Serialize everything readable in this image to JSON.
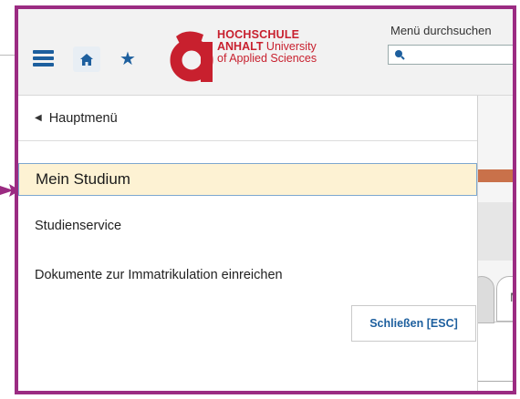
{
  "header": {
    "logo": {
      "line1": "HOCHSCHULE",
      "line2_bold": "ANHALT",
      "line2_rest": " University",
      "line3": "of Applied Sciences"
    },
    "search_label": "Menü durchsuchen",
    "search_value": ""
  },
  "menu": {
    "back_label": "Hauptmenü",
    "items": [
      {
        "label": "Mein Studium",
        "active": true
      },
      {
        "label": "Studienservice",
        "active": false
      },
      {
        "label": "Dokumente zur Immatrikulation einreichen",
        "active": false
      }
    ],
    "close_label": "Schließen [ESC]"
  },
  "background": {
    "tab_label": "M"
  },
  "colors": {
    "highlight_frame": "#9b2b82",
    "brand_red": "#c8202e",
    "nav_blue": "#1d5f9e",
    "active_item_bg": "#fdf2d3",
    "active_item_border": "#7da7cf"
  }
}
